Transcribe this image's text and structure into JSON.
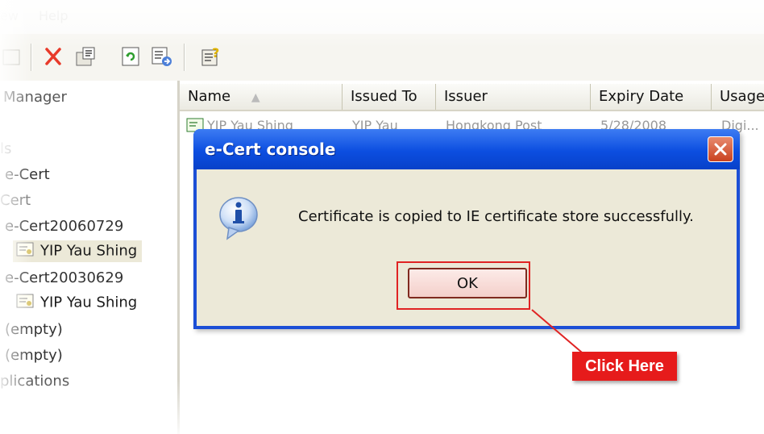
{
  "menubar": {
    "items": [
      "ew",
      "Help"
    ]
  },
  "toolbar": {
    "icons": [
      "box-icon",
      "delete-icon",
      "properties-icon",
      "refresh-icon",
      "export-icon",
      "help-icon"
    ]
  },
  "tree": {
    "items": [
      "Manager",
      "ls",
      "e-Cert",
      "Cert",
      "e-Cert20060729",
      "YIP Yau Shing",
      "e-Cert20030629",
      "YIP Yau Shing",
      "(empty)",
      "(empty)",
      "plications"
    ]
  },
  "list": {
    "columns": [
      "Name",
      "Issued To",
      "Issuer",
      "Expiry Date",
      "Usage"
    ],
    "row": {
      "name": "YIP Yau Shing",
      "issued_to": "YIP Yau",
      "issuer": "Hongkong Post",
      "expiry": "5/28/2008",
      "usage": "Digi..."
    }
  },
  "dialog": {
    "title": "e-Cert console",
    "message": "Certificate is copied to IE certificate store successfully.",
    "ok_label": "OK"
  },
  "callout": {
    "label": "Click Here",
    "color": "#e61b1b"
  },
  "colors": {
    "titlebar": "#0c4ee0",
    "dialog_bg": "#ece9d8",
    "close": "#c9421f"
  }
}
